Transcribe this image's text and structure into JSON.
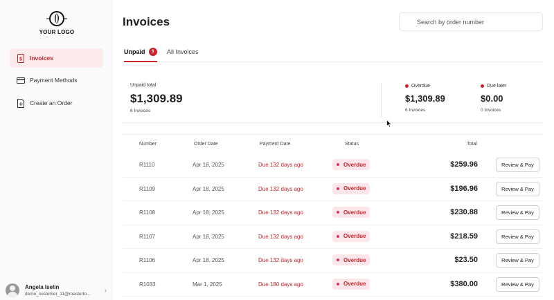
{
  "sidebar": {
    "logo_text": "YOUR LOGO",
    "items": [
      {
        "label": "Invoices",
        "icon": "invoice-icon",
        "active": true
      },
      {
        "label": "Payment Methods",
        "icon": "credit-card-icon",
        "active": false
      },
      {
        "label": "Create an Order",
        "icon": "document-plus-icon",
        "active": false
      }
    ],
    "user": {
      "name": "Angela Iselin",
      "email": "demo_customer_11@roasterto..."
    }
  },
  "header": {
    "title": "Invoices",
    "search_placeholder": "Search by order number"
  },
  "tabs": [
    {
      "label": "Unpaid",
      "badge": "6",
      "active": true
    },
    {
      "label": "All Invoices",
      "active": false
    }
  ],
  "summary": {
    "unpaid": {
      "label": "Unpaid total",
      "amount": "$1,309.89",
      "count": "6 Invoices"
    },
    "overdue": {
      "label": "Overdue",
      "amount": "$1,309.89",
      "count": "6 Invoices",
      "color": "#c8252c"
    },
    "due_later": {
      "label": "Due later",
      "amount": "$0.00",
      "count": "0 Invoices",
      "color": "#c8252c"
    }
  },
  "table": {
    "headers": {
      "number": "Number",
      "order_date": "Order Date",
      "payment_date": "Payment Date",
      "status": "Status",
      "total": "Total"
    },
    "rows": [
      {
        "number": "R1110",
        "order_date": "Apr 18, 2025",
        "payment_date": "Due 132 days ago",
        "status": "Overdue",
        "total": "$259.96",
        "action": "Review & Pay"
      },
      {
        "number": "R1109",
        "order_date": "Apr 18, 2025",
        "payment_date": "Due 132 days ago",
        "status": "Overdue",
        "total": "$196.96",
        "action": "Review & Pay"
      },
      {
        "number": "R1108",
        "order_date": "Apr 18, 2025",
        "payment_date": "Due 132 days ago",
        "status": "Overdue",
        "total": "$230.88",
        "action": "Review & Pay"
      },
      {
        "number": "R1107",
        "order_date": "Apr 18, 2025",
        "payment_date": "Due 132 days ago",
        "status": "Overdue",
        "total": "$218.59",
        "action": "Review & Pay"
      },
      {
        "number": "R1106",
        "order_date": "Apr 18, 2025",
        "payment_date": "Due 132 days ago",
        "status": "Overdue",
        "total": "$23.50",
        "action": "Review & Pay"
      },
      {
        "number": "R1033",
        "order_date": "Mar 1, 2025",
        "payment_date": "Due 180 days ago",
        "status": "Overdue",
        "total": "$380.00",
        "action": "Review & Pay"
      }
    ]
  },
  "colors": {
    "accent": "#c8252c",
    "status_bg": "#fbe6ea"
  }
}
